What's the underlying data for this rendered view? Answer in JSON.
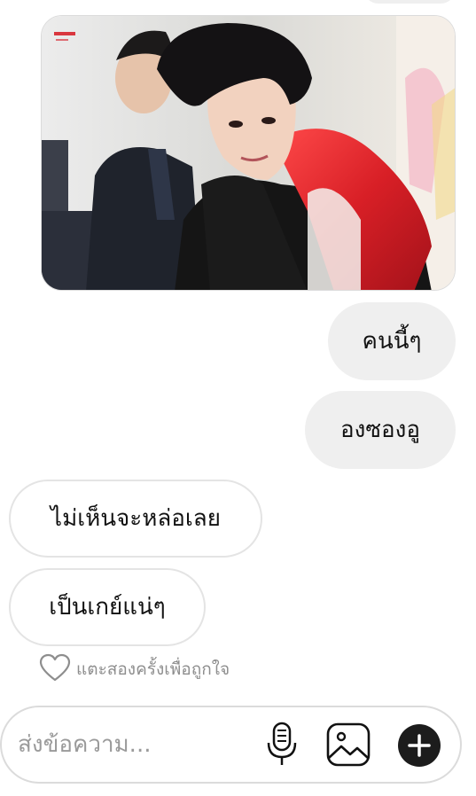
{
  "thread": {
    "messages": [
      {
        "text": "คนนี้ๆ",
        "from": "me"
      },
      {
        "text": "องซองอู",
        "from": "me"
      },
      {
        "text": "ไม่เห็นจะหล่อเลย",
        "from": "them"
      },
      {
        "text": "เป็นเกย์แน่ๆ",
        "from": "them"
      }
    ],
    "like_hint": "แตะสองครั้งเพื่อถูกใจ"
  },
  "composer": {
    "placeholder": "ส่งข้อความ...",
    "icons": [
      "microphone-icon",
      "gallery-icon",
      "plus-icon"
    ]
  },
  "colors": {
    "outgoing_bubble": "#efefef",
    "incoming_border": "#e4e4e4",
    "hint_text": "#8e8e8e",
    "plus_button": "#1c1c1c"
  }
}
